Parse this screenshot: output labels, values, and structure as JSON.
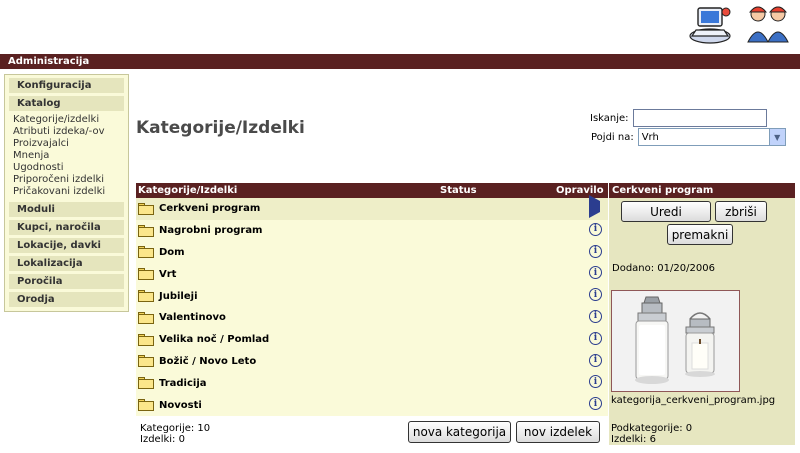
{
  "header": {
    "icons": [
      "computer-admin-icon",
      "workers-icon"
    ]
  },
  "admin_bar": {
    "title": "Administracija"
  },
  "sidebar": {
    "sections": [
      {
        "label": "Konfiguracija"
      },
      {
        "label": "Katalog"
      },
      {
        "label": "Moduli"
      },
      {
        "label": "Kupci, naročila"
      },
      {
        "label": "Lokacije, davki"
      },
      {
        "label": "Lokalizacija"
      },
      {
        "label": "Poročila"
      },
      {
        "label": "Orodja"
      }
    ],
    "catalog_items": [
      "Kategorije/izdelki",
      "Atributi izdeka/-ov",
      "Proizvajalci",
      "Mnenja",
      "Ugodnosti",
      "Priporočeni izdelki",
      "Pričakovani izdelki"
    ]
  },
  "page": {
    "title": "Kategorije/Izdelki"
  },
  "search": {
    "label": "Iskanje:",
    "value": ""
  },
  "goto": {
    "label": "Pojdi na:",
    "selected": "Vrh"
  },
  "table": {
    "columns": {
      "name": "Kategorije/Izdelki",
      "status": "Status",
      "action": "Opravilo"
    },
    "rows": [
      {
        "name": "Cerkveni program",
        "action": "play-icon",
        "selected": true
      },
      {
        "name": "Nagrobni program",
        "action": "info-icon"
      },
      {
        "name": "Dom",
        "action": "info-icon"
      },
      {
        "name": "Vrt",
        "action": "info-icon"
      },
      {
        "name": "Jubileji",
        "action": "info-icon"
      },
      {
        "name": "Valentinovo",
        "action": "info-icon"
      },
      {
        "name": "Velika noč / Pomlad",
        "action": "info-icon"
      },
      {
        "name": "Božič / Novo Leto",
        "action": "info-icon"
      },
      {
        "name": "Tradicija",
        "action": "info-icon"
      },
      {
        "name": "Novosti",
        "action": "info-icon"
      }
    ],
    "footer": {
      "categories": "Kategorije: 10",
      "products": "Izdelki: 0",
      "new_category_label": "nova kategorija",
      "new_product_label": "nov izdelek"
    }
  },
  "detail": {
    "title": "Cerkveni program",
    "edit_label": "Uredi",
    "delete_label": "zbriši",
    "move_label": "premakni",
    "added": "Dodano: 01/20/2006",
    "filename": "kategorija_cerkveni_program.jpg",
    "subcategories": "Podkategorije: 0",
    "products": "Izdelki: 6"
  },
  "colors": {
    "bar": "#5a2121",
    "panel": "#fafad9",
    "sidebar_head": "#e5e5bd",
    "right_panel": "#e6e6c0"
  }
}
